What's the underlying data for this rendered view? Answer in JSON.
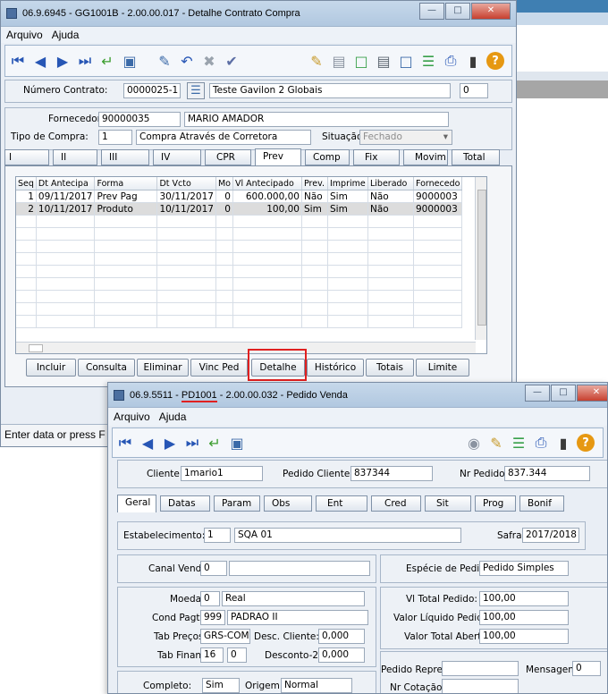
{
  "win1": {
    "title": "06.9.6945 - GG1001B - 2.00.00.017 - Detalhe Contrato Compra",
    "menu": [
      "Arquivo",
      "Ajuda"
    ],
    "contract": {
      "numero_label": "Número Contrato:",
      "numero": "0000025-1",
      "desc": "Teste Gavilon 2 Globais",
      "extra": "0",
      "fornecedor_label": "Fornecedor:",
      "fornecedor_code": "90000035",
      "fornecedor_name": "MARIO AMADOR",
      "tipo_label": "Tipo de Compra:",
      "tipo_code": "1",
      "tipo_desc": "Compra Através de Corretora",
      "situacao_label": "Situação:",
      "situacao": "Fechado"
    },
    "tabs": [
      "I",
      "II",
      "III",
      "IV",
      "CPR",
      "Prev",
      "Comp",
      "Fix",
      "Movim",
      "Total"
    ],
    "grid": {
      "headers": [
        "Seq",
        "Dt Antecipa",
        "Forma",
        "Dt Vcto",
        "Mo",
        "Vl Antecipado",
        "Prev.",
        "Imprime",
        "Liberado",
        "Fornecedo"
      ],
      "rows": [
        [
          "1",
          "09/11/2017",
          "Prev Pag",
          "30/11/2017",
          "0",
          "600.000,00",
          "Não",
          "Sim",
          "Não",
          "9000003"
        ],
        [
          "2",
          "10/11/2017",
          "Produto",
          "10/11/2017",
          "0",
          "100,00",
          "Sim",
          "Sim",
          "Não",
          "9000003"
        ]
      ]
    },
    "buttons": [
      "Incluir",
      "Consulta",
      "Eliminar",
      "Vinc Ped",
      "Detalhe",
      "Histórico",
      "Totais",
      "Limite"
    ],
    "status": "Enter data or press F"
  },
  "win2": {
    "title_prefix": "06.9.5511 - ",
    "title_code": "PD1001",
    "title_suffix": " - 2.00.00.032 - Pedido Venda",
    "menu": [
      "Arquivo",
      "Ajuda"
    ],
    "header": {
      "cliente_label": "Cliente:",
      "cliente": "1mario1",
      "pedcli_label": "Pedido Cliente:",
      "pedcli": "837344",
      "nrped_label": "Nr Pedido:",
      "nrped": "837.344"
    },
    "tabs": [
      "Geral",
      "Datas",
      "Param",
      "Obs",
      "Ent",
      "Cred",
      "Sit",
      "Prog",
      "Bonif"
    ],
    "estab_label": "Estabelecimento:",
    "estab_code": "1",
    "estab_name": "SQA 01",
    "safra_label": "Safra:",
    "safra": "2017/2018",
    "canal_label": "Canal Venda:",
    "canal": "0",
    "especie_label": "Espécie de Pedido:",
    "especie": "Pedido Simples",
    "moeda_label": "Moeda:",
    "moeda_code": "0",
    "moeda_name": "Real",
    "cond_label": "Cond Pagto:",
    "cond_code": "999",
    "cond_name": "PADRAO II",
    "tabprec_label": "Tab Preços:",
    "tabprec": "GRS-COMP",
    "desccli_label": "Desc. Cliente:",
    "desccli": "0,000",
    "tabfin_label": "Tab Financ:",
    "tabfin": "16",
    "tabfin2": "0",
    "desc2_label": "Desconto-2:",
    "desc2": "0,000",
    "vltot_label": "Vl Total Pedido:",
    "vltot": "100,00",
    "vlliq_label": "Valor Líquido Pedido:",
    "vlliq": "100,00",
    "vlab_label": "Valor Total Aberto:",
    "vlab": "100,00",
    "repres_label": "Pedido Repres:",
    "mensagem_label": "Mensagem:",
    "mensagem": "0",
    "cotacao_label": "Nr Cotação:",
    "completo_label": "Completo:",
    "completo": "Sim",
    "origem_label": "Origem:",
    "origem": "Normal"
  }
}
